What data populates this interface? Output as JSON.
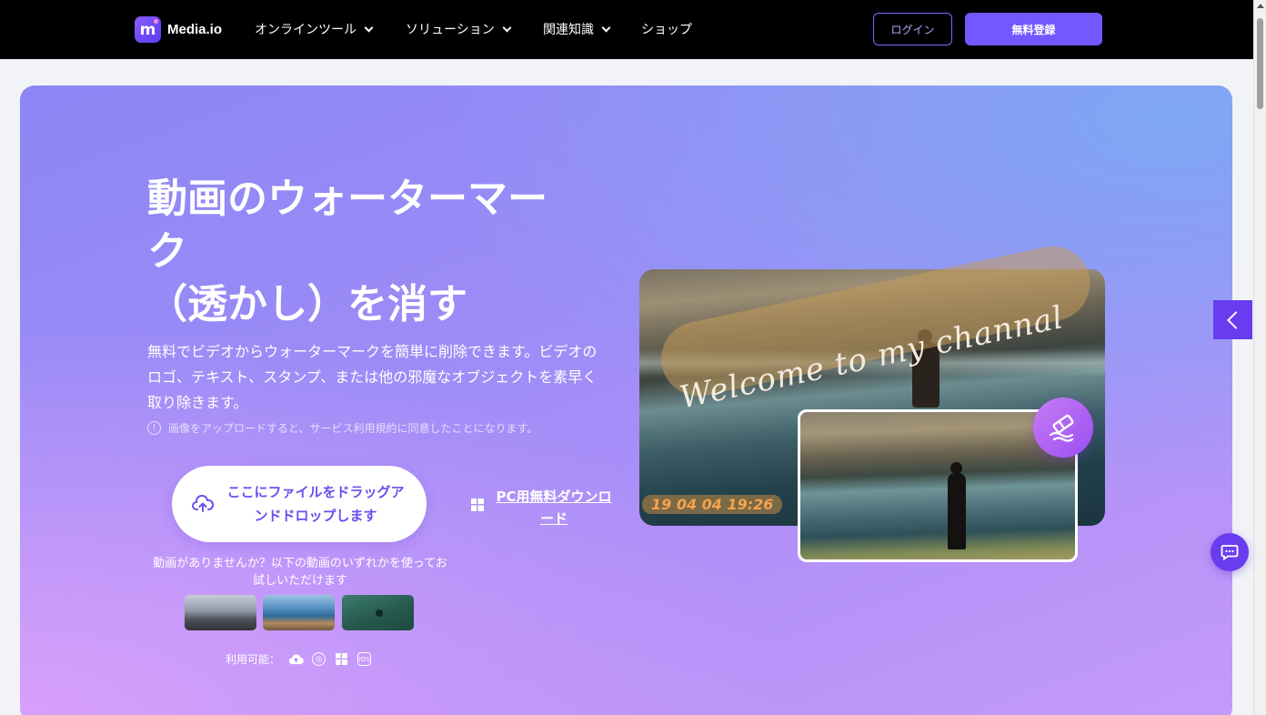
{
  "nav": {
    "logo_text": "Media.io",
    "items": [
      {
        "label": "オンラインツール",
        "has_dropdown": true
      },
      {
        "label": "ソリューション",
        "has_dropdown": true
      },
      {
        "label": "関連知識",
        "has_dropdown": true
      },
      {
        "label": "ショップ",
        "has_dropdown": false
      }
    ],
    "login_label": "ログイン",
    "signup_label": "無料登録"
  },
  "hero": {
    "title_lines": [
      "動画のウォーターマー",
      "ク",
      "（透かし）を消す"
    ],
    "description": "無料でビデオからウォーターマークを簡単に削除できます。ビデオのロゴ、テキスト、スタンプ、または他の邪魔なオブジェクトを素早く取り除きます。",
    "notice": "画像をアップロードすると、サービス利用規約に同意したことになります。",
    "upload_label": "ここにファイルをドラッグアンドドロップします",
    "pc_download_label": "PC用無料ダウンロード",
    "sample_text": "動画がありませんか？以下の動画のいずれかを使ってお試しいただけます",
    "available_label": "利用可能：",
    "available_icons": [
      "cloud-upload-icon",
      "browser-icon",
      "windows-icon",
      "ios-icon"
    ],
    "ios_text": "iOS",
    "preview": {
      "watermark_text": "Welcome to my channal",
      "timestamp_text": "19 04 04 19:26"
    }
  },
  "colors": {
    "accent": "#7357ff",
    "nav_bg": "#000000",
    "hero_start": "#8c86f4",
    "hero_end": "#c49bf9"
  }
}
